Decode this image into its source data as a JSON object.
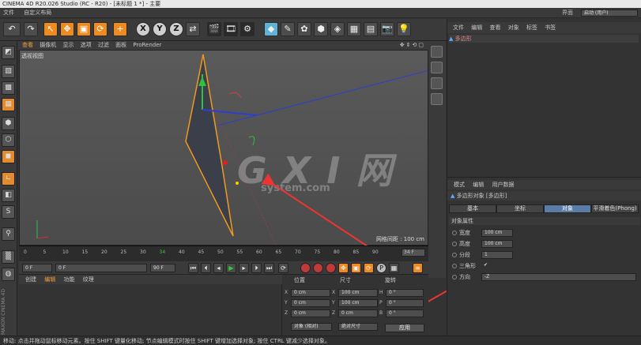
{
  "titlebar": {
    "title": "CINEMA 4D R20.026 Studio (RC - R20) - [未标题 1 *] - 主要"
  },
  "menubar": {
    "items": [
      "文件",
      "自定义布局"
    ],
    "layout_label": "界面",
    "layout_value": "启动 (用户)"
  },
  "viewport": {
    "menu": [
      "查看",
      "摄像机",
      "显示",
      "选项",
      "过滤",
      "面板",
      "ProRender"
    ],
    "label": "透视视图",
    "grid_label": "网格间距 : 100 cm"
  },
  "timeline": {
    "ticks": [
      "0",
      "5",
      "10",
      "15",
      "20",
      "25",
      "30",
      "34",
      "40",
      "45",
      "50",
      "55",
      "60",
      "65",
      "70",
      "75",
      "80",
      "85",
      "90"
    ],
    "end_frame": "34 F"
  },
  "transport": {
    "start": "0 F",
    "current": "0 F",
    "end": "90 F",
    "max": "90 F"
  },
  "material": {
    "menu": [
      "创建",
      "编辑",
      "功能",
      "纹理"
    ]
  },
  "coords": {
    "headers": [
      "位置",
      "尺寸",
      "旋转"
    ],
    "pos_labels": [
      "X",
      "Y",
      "Z"
    ],
    "pos": [
      "0 cm",
      "0 cm",
      "0 cm"
    ],
    "size_labels": [
      "X",
      "Y",
      "Z"
    ],
    "size": [
      "100 cm",
      "100 cm",
      "0 cm"
    ],
    "rot_labels": [
      "H",
      "P",
      "B"
    ],
    "rot": [
      "0 °",
      "0 °",
      "0 °"
    ],
    "mode1": "对象 (相对)",
    "mode2": "绝对尺寸",
    "apply": "应用"
  },
  "objects": {
    "menu": [
      "文件",
      "编辑",
      "查看",
      "对象",
      "标签",
      "书签"
    ],
    "row": "多边形"
  },
  "attributes": {
    "menu": [
      "模式",
      "编辑",
      "用户数据"
    ],
    "title": "多边形对象 [多边形]",
    "tabs": [
      "基本",
      "坐标",
      "对象",
      "平滑着色(Phong)"
    ],
    "section": "对象属性",
    "rows": [
      {
        "label": "宽度",
        "value": "100 cm"
      },
      {
        "label": "高度",
        "value": "100 cm"
      },
      {
        "label": "分段",
        "value": "1"
      },
      {
        "label": "三角形",
        "value": "✔"
      },
      {
        "label": "方向",
        "value": "-Z"
      }
    ]
  },
  "watermark": {
    "main": "G X I 网",
    "sub": "system.com"
  },
  "status": {
    "text": "移动: 点击并拖动鼠标移动元素。按住 SHIFT 键量化移动; 节点编辑模式时按住 SHIFT 键增加选择对象; 按住 CTRL 键减少选择对象。"
  }
}
